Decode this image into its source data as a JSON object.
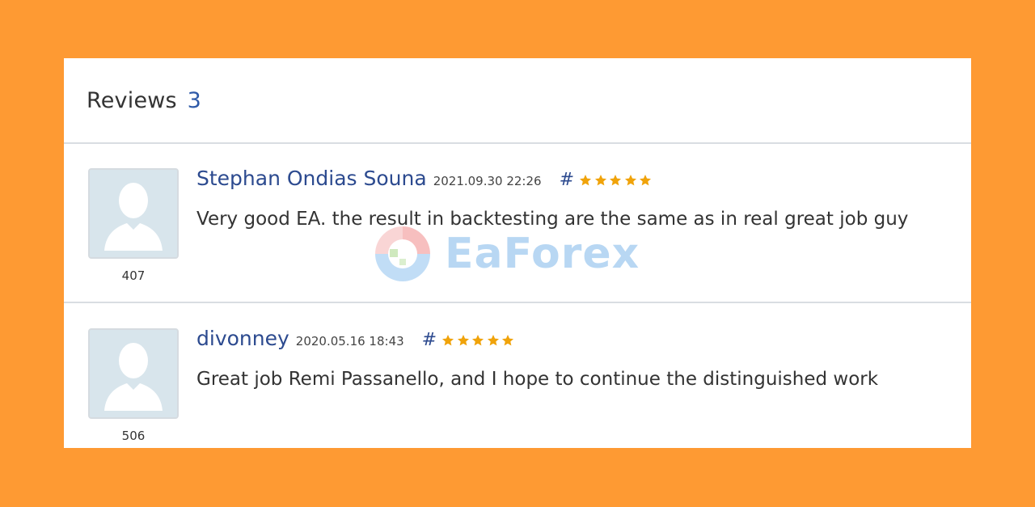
{
  "header": {
    "title": "Reviews",
    "count": "3"
  },
  "reviews": [
    {
      "author": "Stephan Ondias Souna",
      "date": "2021.09.30 22:26",
      "hash": "#",
      "stars": 5,
      "text": "Very good EA. the result in backtesting are the same as in real great job guy",
      "user_rating": "407"
    },
    {
      "author": "divonney",
      "date": "2020.05.16 18:43",
      "hash": "#",
      "stars": 5,
      "text": "Great job Remi Passanello, and I hope to continue the distinguished work",
      "user_rating": "506"
    }
  ],
  "watermark": {
    "text": "EaForex"
  },
  "colors": {
    "background": "#fe9a33",
    "accent": "#2c4a8f",
    "star": "#f0a30a"
  }
}
